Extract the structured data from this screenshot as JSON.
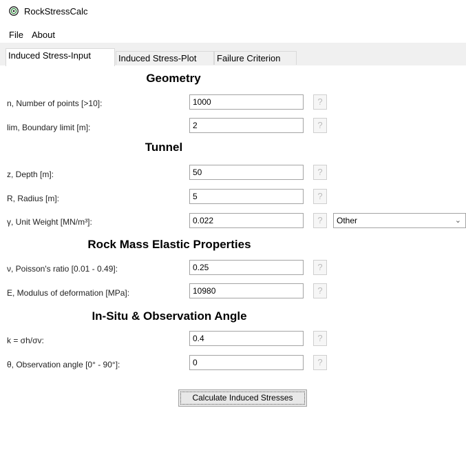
{
  "window": {
    "title": "RockStressCalc"
  },
  "menu": [
    "File",
    "About"
  ],
  "tabs": [
    "Induced Stress-Input",
    "Induced Stress-Plot",
    "Failure Criterion"
  ],
  "sections": {
    "geometry": "Geometry",
    "tunnel": "Tunnel",
    "rock": "Rock Mass Elastic Properties",
    "insitu": "In-Situ & Observation Angle"
  },
  "fields": [
    {
      "label": "n, Number of points [>10]:",
      "value": "1000"
    },
    {
      "label": "lim, Boundary limit [m]:",
      "value": "2"
    },
    {
      "label": "z, Depth [m]:",
      "value": "50"
    },
    {
      "label": "R, Radius [m]:",
      "value": "5"
    },
    {
      "label": "γ, Unit Weight [MN/m³]:",
      "value": "0.022"
    },
    {
      "label": "ν, Poisson's ratio [0.01 - 0.49]:",
      "value": "0.25"
    },
    {
      "label": "E, Modulus of deformation [MPa]:",
      "value": "10980"
    },
    {
      "label": "k = σh/σv:",
      "value": "0.4"
    },
    {
      "label": "θ, Observation angle [0° - 90°]:",
      "value": "0"
    }
  ],
  "help_glyph": "?",
  "unit_weight_select": "Other",
  "calculate_button": "Calculate Induced Stresses"
}
